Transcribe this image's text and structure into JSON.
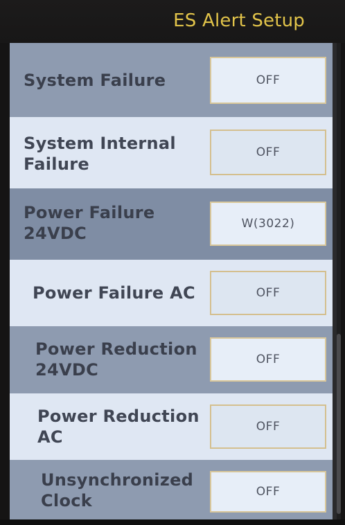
{
  "header": {
    "title": "ES Alert Setup"
  },
  "alerts": [
    {
      "label_line1": "System Failure",
      "label_line2": "",
      "value": "OFF"
    },
    {
      "label_line1": "System Internal",
      "label_line2": "Failure",
      "value": "OFF"
    },
    {
      "label_line1": "Power Failure",
      "label_line2": "24VDC",
      "value": "W(3022)"
    },
    {
      "label_line1": "Power Failure AC",
      "label_line2": "",
      "value": "OFF"
    },
    {
      "label_line1": "Power Reduction",
      "label_line2": "24VDC",
      "value": "OFF"
    },
    {
      "label_line1": "Power Reduction",
      "label_line2": "AC",
      "value": "OFF"
    },
    {
      "label_line1": "Unsynchronized",
      "label_line2": "Clock",
      "value": "OFF"
    }
  ],
  "colors": {
    "title": "#e2c44a",
    "row_dark": "#8e9bb0",
    "row_light": "#dfe7f3",
    "button_border": "#d9c79a"
  }
}
